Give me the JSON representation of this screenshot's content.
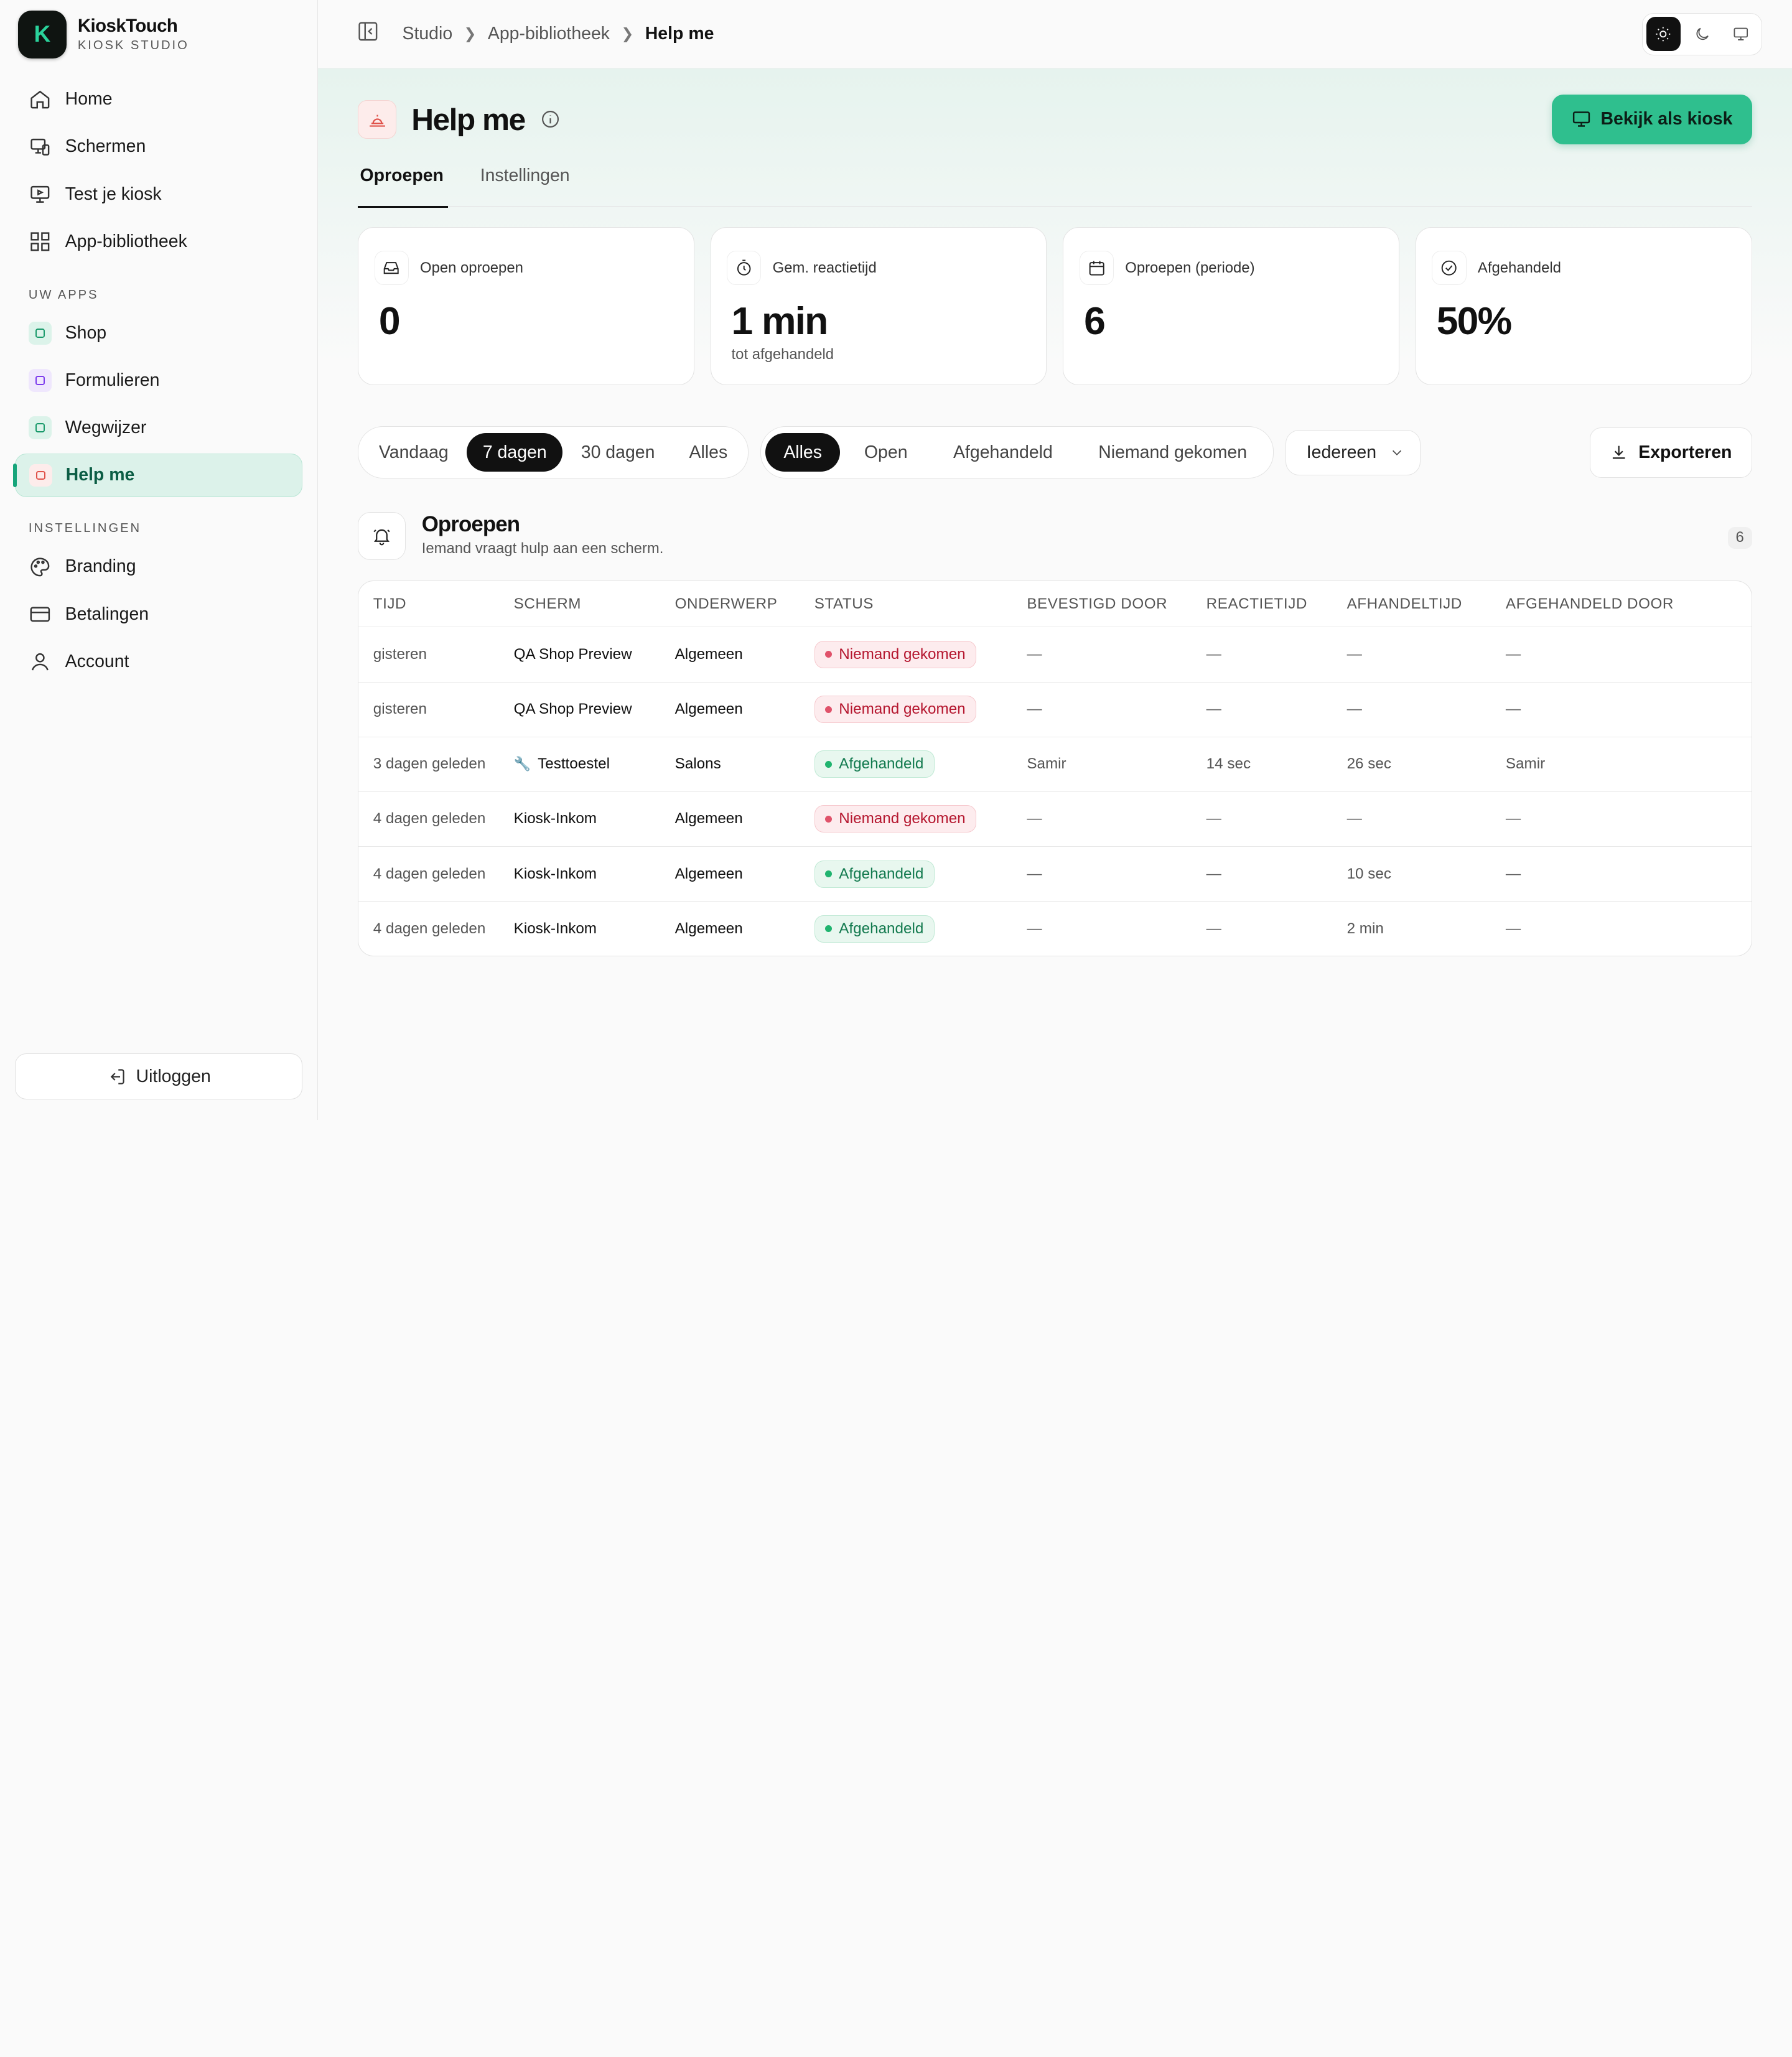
{
  "brand": {
    "name": "KioskTouch",
    "subtitle": "KIOSK STUDIO",
    "logo_letter": "K",
    "accent": "#2fbf8e"
  },
  "sidebar": {
    "main_items": [
      {
        "label": "Home",
        "icon": "home-icon"
      },
      {
        "label": "Schermen",
        "icon": "screens-icon"
      },
      {
        "label": "Test je kiosk",
        "icon": "test-kiosk-icon"
      },
      {
        "label": "App-bibliotheek",
        "icon": "grid-icon"
      }
    ],
    "apps_label": "UW APPS",
    "apps": [
      {
        "label": "Shop",
        "icon": "shop-icon",
        "color": "#1a9a6b",
        "bg": "#dcf3ea"
      },
      {
        "label": "Formulieren",
        "icon": "forms-icon",
        "color": "#7c3aed",
        "bg": "#efe7fd"
      },
      {
        "label": "Wegwijzer",
        "icon": "map-icon",
        "color": "#1a9a6b",
        "bg": "#dcf3ea"
      },
      {
        "label": "Help me",
        "icon": "bell-icon",
        "color": "#e0524a",
        "bg": "#fdeceb",
        "active": true
      }
    ],
    "settings_label": "INSTELLINGEN",
    "settings": [
      {
        "label": "Branding",
        "icon": "palette-icon"
      },
      {
        "label": "Betalingen",
        "icon": "card-icon"
      },
      {
        "label": "Account",
        "icon": "user-icon"
      }
    ],
    "logout_label": "Uitloggen"
  },
  "breadcrumb": {
    "items": [
      "Studio",
      "App-bibliotheek"
    ],
    "current": "Help me"
  },
  "page": {
    "title": "Help me",
    "kiosk_button": "Bekijk als kiosk",
    "tabs": [
      {
        "label": "Oproepen",
        "active": true
      },
      {
        "label": "Instellingen",
        "active": false
      }
    ]
  },
  "stats": [
    {
      "label": "Open oproepen",
      "value": "0",
      "sub": "",
      "icon": "inbox-icon"
    },
    {
      "label": "Gem. reactietijd",
      "value": "1 min",
      "sub": "tot afgehandeld",
      "icon": "timer-icon"
    },
    {
      "label": "Oproepen (periode)",
      "value": "6",
      "sub": "",
      "icon": "calendar-icon"
    },
    {
      "label": "Afgehandeld",
      "value": "50%",
      "sub": "",
      "icon": "check-circle-icon"
    }
  ],
  "filters": {
    "period": [
      "Vandaag",
      "7 dagen",
      "30 dagen",
      "Alles"
    ],
    "period_selected": "7 dagen",
    "status": [
      "Alles",
      "Open",
      "Afgehandeld",
      "Niemand gekomen"
    ],
    "status_selected": "Alles",
    "people_select": "Iedereen",
    "export_label": "Exporteren"
  },
  "calls": {
    "title": "Oproepen",
    "subtitle": "Iemand vraagt hulp aan een scherm.",
    "count": "6",
    "columns": [
      "TIJD",
      "SCHERM",
      "ONDERWERP",
      "STATUS",
      "BEVESTIGD DOOR",
      "REACTIETIJD",
      "AFHANDELTIJD",
      "AFGEHANDELD DOOR"
    ],
    "rows": [
      {
        "time": "gisteren",
        "screen": "QA Shop Preview",
        "topic": "Algemeen",
        "status": "Niemand gekomen",
        "status_kind": "red",
        "confirmed_by": "—",
        "reaction": "—",
        "handling": "—",
        "handled_by": "—"
      },
      {
        "time": "gisteren",
        "screen": "QA Shop Preview",
        "topic": "Algemeen",
        "status": "Niemand gekomen",
        "status_kind": "red",
        "confirmed_by": "—",
        "reaction": "—",
        "handling": "—",
        "handled_by": "—"
      },
      {
        "time": "3 dagen geleden",
        "screen": "Testtoestel",
        "screen_icon": "wrench-icon",
        "topic": "Salons",
        "status": "Afgehandeld",
        "status_kind": "green",
        "confirmed_by": "Samir",
        "reaction": "14 sec",
        "handling": "26 sec",
        "handled_by": "Samir"
      },
      {
        "time": "4 dagen geleden",
        "screen": "Kiosk-Inkom",
        "topic": "Algemeen",
        "status": "Niemand gekomen",
        "status_kind": "red",
        "confirmed_by": "—",
        "reaction": "—",
        "handling": "—",
        "handled_by": "—"
      },
      {
        "time": "4 dagen geleden",
        "screen": "Kiosk-Inkom",
        "topic": "Algemeen",
        "status": "Afgehandeld",
        "status_kind": "green",
        "confirmed_by": "—",
        "reaction": "—",
        "handling": "10 sec",
        "handled_by": "—"
      },
      {
        "time": "4 dagen geleden",
        "screen": "Kiosk-Inkom",
        "topic": "Algemeen",
        "status": "Afgehandeld",
        "status_kind": "green",
        "confirmed_by": "—",
        "reaction": "—",
        "handling": "2 min",
        "handled_by": "—"
      }
    ]
  }
}
